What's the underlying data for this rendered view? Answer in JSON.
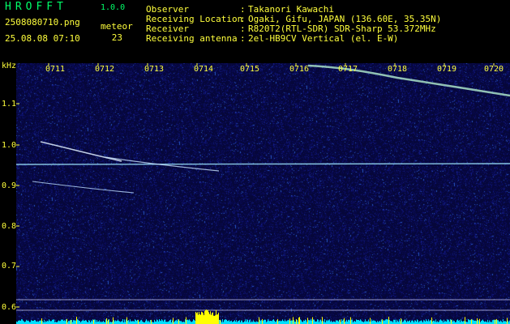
{
  "header": {
    "app_name": "HROFFT",
    "version": "1.0.0",
    "filename": "2508080710.png",
    "datetime": "25.08.08 07:10",
    "meteor_label": "meteor",
    "meteor_count": "23",
    "info": [
      {
        "label": "Observer",
        "value": "Takanori Kawachi"
      },
      {
        "label": "Receiving Location",
        "value": "Ogaki, Gifu, JAPAN (136.60E, 35.35N)"
      },
      {
        "label": "Receiver",
        "value": "R820T2(RTL-SDR) SDR-Sharp 53.372MHz"
      },
      {
        "label": "Receiving antenna",
        "value": "2el-HB9CV Vertical (el. E-W)"
      }
    ]
  },
  "spectrogram": {
    "y_unit": "kHz",
    "y_ticks": [
      "1.1",
      "1.0",
      "0.9",
      "0.8",
      "0.7",
      "0.6"
    ],
    "time_ticks": [
      "0711",
      "0712",
      "0713",
      "0714",
      "0715",
      "0716",
      "0717",
      "0718",
      "0719",
      "0720"
    ],
    "colors": {
      "background": "#06073a",
      "label": "#ffff3c",
      "carrier": "#9fe8ff",
      "trace": "#e0f0ff",
      "baseline": "#00e0ff",
      "peak": "#ffff00"
    }
  }
}
